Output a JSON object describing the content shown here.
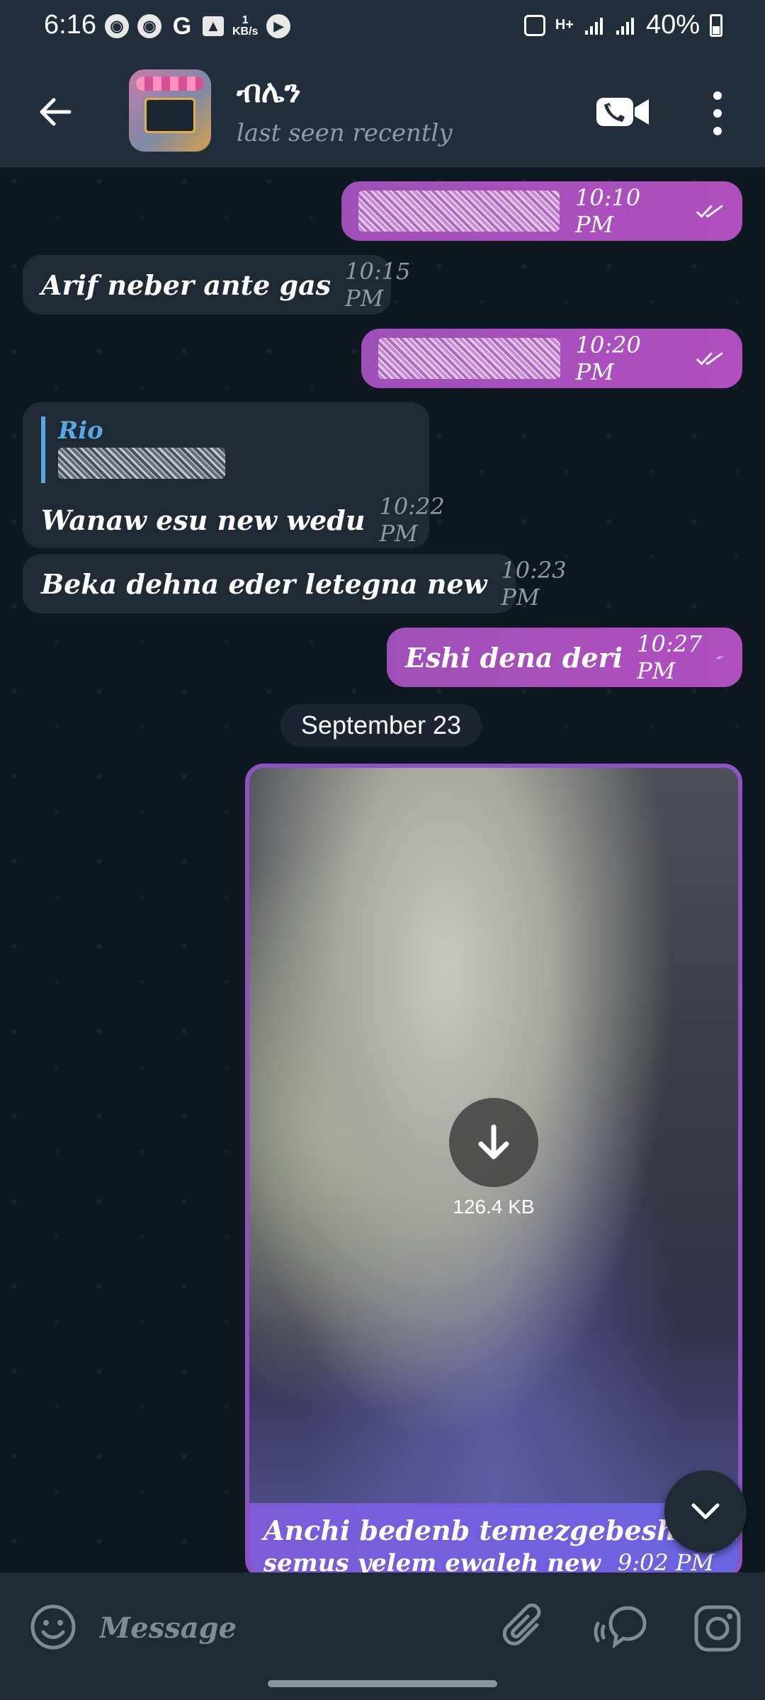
{
  "status_bar": {
    "time": "6:16",
    "kb_rate": "1",
    "kb_unit": "KB/s",
    "network": "H+",
    "battery": "40%"
  },
  "header": {
    "contact_name": "ብሌን",
    "status": "last seen recently"
  },
  "messages": [
    {
      "direction": "out",
      "text": "",
      "time": "10:10 PM",
      "read": true
    },
    {
      "direction": "in",
      "text": "Arif neber ante gas",
      "time": "10:15 PM"
    },
    {
      "direction": "out",
      "text": "",
      "time": "10:20 PM",
      "read": true
    },
    {
      "direction": "in",
      "reply_to": "Rio",
      "text": "Wanaw esu new wedu",
      "time": "10:22 PM"
    },
    {
      "direction": "in",
      "text": "Beka dehna eder letegna new",
      "time": "10:23 PM"
    },
    {
      "direction": "out",
      "text": "Eshi dena deri",
      "time": "10:27 PM",
      "read": true
    }
  ],
  "date_separator": "September 23",
  "media_message": {
    "size": "126.4 KB",
    "caption_line1": "Anchi bedenb temezgebeshal endae",
    "caption_line2": "semus yelem ewaleh new",
    "time": "9:02 PM"
  },
  "input": {
    "placeholder": "Message"
  },
  "colors": {
    "outgoing_bubble": "#b14fc0",
    "incoming_bubble": "#1f2a35",
    "header_bg": "#232e3c",
    "reply_accent": "#5aa7e6"
  }
}
